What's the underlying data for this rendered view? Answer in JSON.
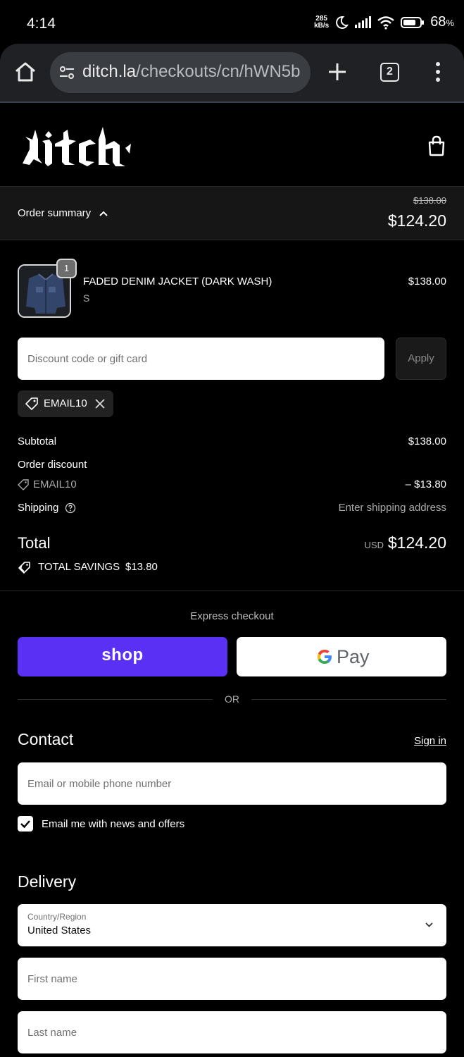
{
  "status_bar": {
    "time": "4:14",
    "net_speed_value": "285",
    "net_speed_unit": "kB/s",
    "battery": "68",
    "battery_unit": "%"
  },
  "browser": {
    "url_host": "ditch.la",
    "url_path": "/checkouts/cn/hWN5b",
    "tab_count": "2"
  },
  "order_summary": {
    "label": "Order summary",
    "original_price": "$138.00",
    "price": "$124.20"
  },
  "product": {
    "quantity": "1",
    "name": "FADED DENIM JACKET (DARK WASH)",
    "variant": "S",
    "price": "$138.00"
  },
  "discount": {
    "placeholder": "Discount code or gift card",
    "apply_label": "Apply",
    "applied_code": "EMAIL10"
  },
  "totals": {
    "subtotal_label": "Subtotal",
    "subtotal_value": "$138.00",
    "order_discount_label": "Order discount",
    "discount_code": "EMAIL10",
    "discount_value": "– $13.80",
    "shipping_label": "Shipping",
    "shipping_value": "Enter shipping address",
    "total_label": "Total",
    "currency": "USD",
    "total_value": "$124.20",
    "savings_label": "TOTAL SAVINGS",
    "savings_value": "$13.80"
  },
  "express": {
    "label": "Express checkout",
    "shop_label": "shop",
    "gpay_label": "Pay",
    "or_label": "OR"
  },
  "contact": {
    "title": "Contact",
    "sign_in": "Sign in",
    "email_placeholder": "Email or mobile phone number",
    "newsletter_label": "Email me with news and offers",
    "newsletter_checked": true
  },
  "delivery": {
    "title": "Delivery",
    "country_caption": "Country/Region",
    "country_value": "United States",
    "first_name_placeholder": "First name",
    "last_name_placeholder": "Last name"
  },
  "colors": {
    "shop_pay": "#5a31f4",
    "background": "#000000"
  }
}
